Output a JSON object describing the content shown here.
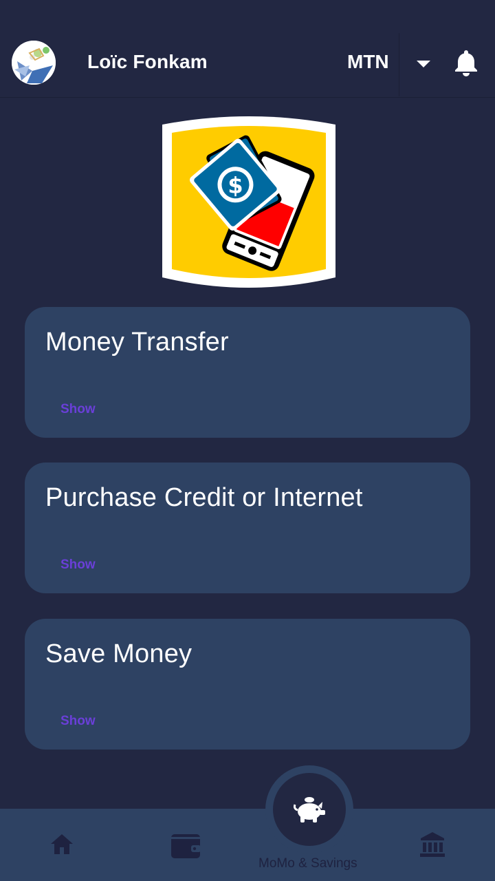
{
  "header": {
    "user_name": "Loïc Fonkam",
    "operator": "MTN",
    "avatar_icon": "avatar-logo-icon",
    "dropdown_icon": "caret-down-icon",
    "notification_icon": "bell-icon"
  },
  "logo": {
    "icon": "mobile-money-logo-icon",
    "colors": {
      "frame": "#ffffff",
      "fill": "#ffcc00",
      "note": "#006aa0",
      "screen": "#ff0000"
    }
  },
  "cards": [
    {
      "title": "Money Transfer",
      "action": "Show"
    },
    {
      "title": "Purchase Credit or Internet",
      "action": "Show"
    },
    {
      "title": "Save Money",
      "action": "Show"
    }
  ],
  "bottom_nav": {
    "items": [
      {
        "icon": "home-icon"
      },
      {
        "icon": "wallet-icon"
      },
      {
        "icon": "piggy-bank-icon",
        "label": "MoMo & Savings",
        "active": true
      },
      {
        "icon": "bank-icon"
      }
    ]
  },
  "colors": {
    "background": "#222742",
    "card": "#2e4263",
    "action_text": "#6a3fd8",
    "nav_icon": "#1e2240"
  }
}
